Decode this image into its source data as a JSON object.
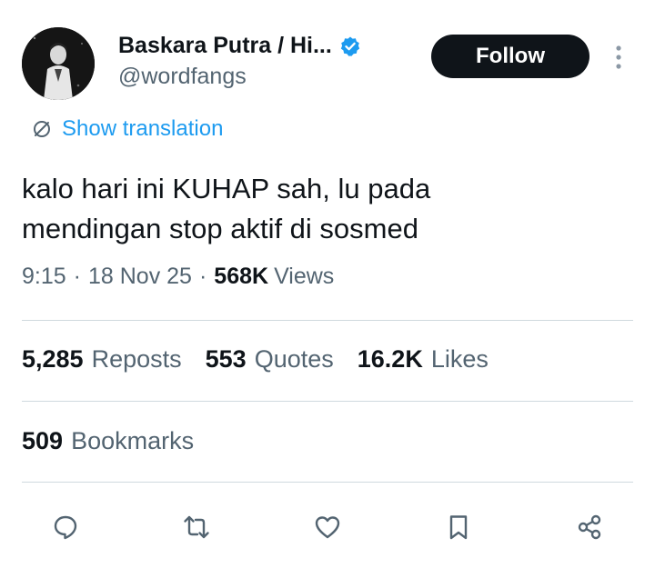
{
  "author": {
    "name": "Baskara Putra / Hi...",
    "handle": "@wordfangs",
    "verified": true
  },
  "follow_label": "Follow",
  "translate_label": "Show translation",
  "tweet": {
    "line1": "kalo hari ini KUHAP sah, lu pada",
    "line2": "mendingan stop aktif di sosmed"
  },
  "meta": {
    "time": "9:15",
    "separator": "·",
    "date": "18 Nov 25",
    "views_count": "568K",
    "views_label": "Views"
  },
  "stats": {
    "reposts": {
      "count": "5,285",
      "label": "Reposts"
    },
    "quotes": {
      "count": "553",
      "label": "Quotes"
    },
    "likes": {
      "count": "16.2K",
      "label": "Likes"
    }
  },
  "bookmarks": {
    "count": "509",
    "label": "Bookmarks"
  },
  "actions": [
    "reply-icon",
    "repost-icon",
    "like-icon",
    "bookmark-icon",
    "share-icon"
  ],
  "colors": {
    "accent": "#1d9bf0",
    "text": "#0f1419",
    "secondary": "#536471",
    "divider": "#cfd9de"
  }
}
